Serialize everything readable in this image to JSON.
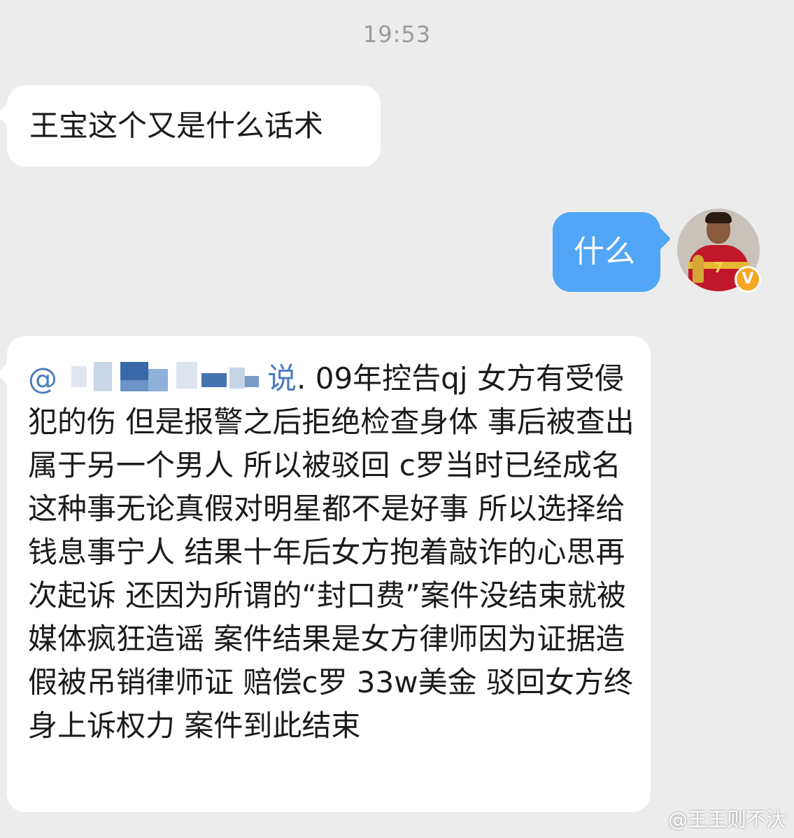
{
  "timestamp": "19:53",
  "messages": [
    {
      "side": "left",
      "text": "王宝这个又是什么话术"
    },
    {
      "side": "right",
      "text": "什么"
    },
    {
      "side": "left",
      "mention_prefix": "@",
      "mention_tail": "说",
      "text": ". 09年控告qj  女方有受侵犯的伤 但是报警之后拒绝检查身体 事后被查出属于另一个男人 所以被驳回  c罗当时已经成名 这种事无论真假对明星都不是好事 所以选择给钱息事宁人 结果十年后女方抱着敲诈的心思再次起诉 还因为所谓的“封口费”案件没结束就被媒体疯狂造谣  案件结果是女方律师因为证据造假被吊销律师证 赔偿c罗 33w美金 驳回女方终身上诉权力 案件到此结束"
    }
  ],
  "avatar": {
    "badge": "V",
    "jersey_number": "7"
  },
  "watermark": "@王王则不汏",
  "colors": {
    "background": "#ececec",
    "bubble_in": "#ffffff",
    "bubble_out": "#51a6f7",
    "mention": "#4c7cbf",
    "badge": "#f5a623"
  }
}
